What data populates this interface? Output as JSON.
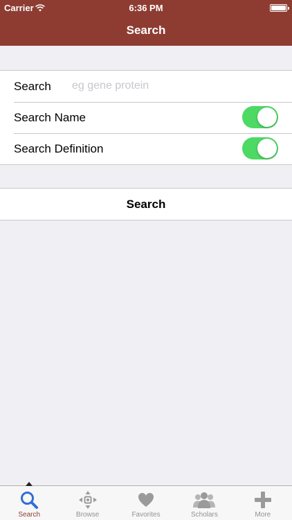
{
  "status_bar": {
    "carrier": "Carrier",
    "time": "6:36 PM",
    "battery_level": 1.0
  },
  "nav": {
    "title": "Search"
  },
  "form": {
    "search_label": "Search",
    "search_value": "",
    "search_placeholder": "eg gene protein",
    "search_name_label": "Search Name",
    "search_name_on": true,
    "search_definition_label": "Search Definition",
    "search_definition_on": true
  },
  "action": {
    "search_button_label": "Search"
  },
  "tabs": [
    {
      "label": "Search",
      "icon": "magnifier-icon",
      "active": true
    },
    {
      "label": "Browse",
      "icon": "browse-arrows-icon",
      "active": false
    },
    {
      "label": "Favorites",
      "icon": "heart-icon",
      "active": false
    },
    {
      "label": "Scholars",
      "icon": "people-icon",
      "active": false
    },
    {
      "label": "More",
      "icon": "plus-icon",
      "active": false
    }
  ],
  "colors": {
    "nav_background": "#8e3c32",
    "active_tab": "#8e3c32",
    "toggle_on": "#4cd964",
    "background": "#efeff4"
  }
}
